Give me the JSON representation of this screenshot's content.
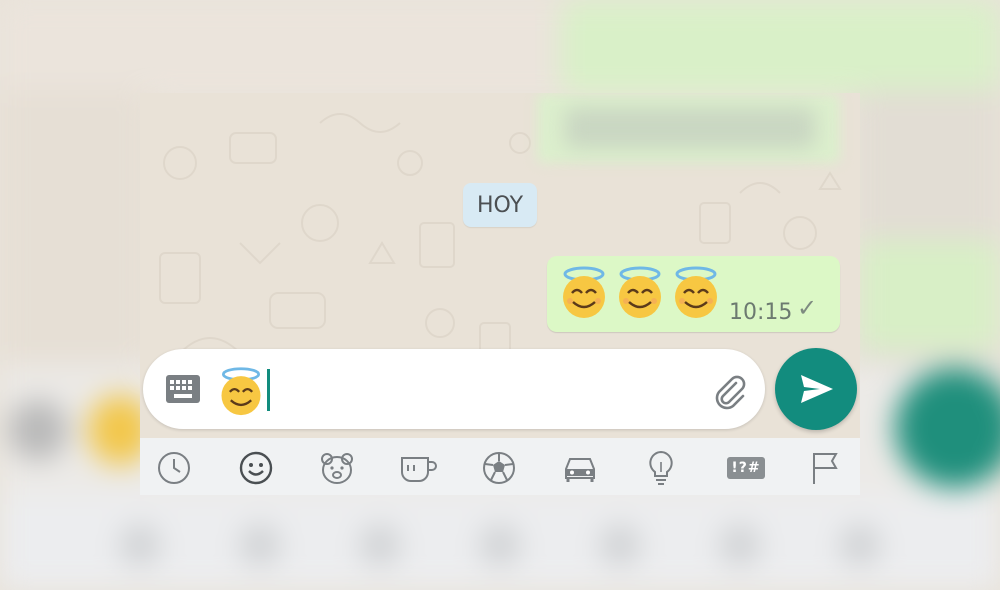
{
  "chat": {
    "date_chip": "HOY",
    "outgoing_message": {
      "emoji_count": 3,
      "emoji_name": "smiling-face-with-halo",
      "time": "10:15",
      "status": "sent-check"
    }
  },
  "composer": {
    "keyboard_toggle_icon": "keyboard-icon",
    "typed_emoji": "smiling-face-with-halo",
    "attach_icon": "paperclip-icon",
    "send_icon": "send-arrow-icon"
  },
  "emoji_tabs": [
    {
      "name": "recent-icon",
      "selected": false
    },
    {
      "name": "smileys-icon",
      "selected": true
    },
    {
      "name": "animals-icon",
      "selected": false
    },
    {
      "name": "food-icon",
      "selected": false
    },
    {
      "name": "activity-icon",
      "selected": false
    },
    {
      "name": "travel-icon",
      "selected": false
    },
    {
      "name": "objects-icon",
      "selected": false
    },
    {
      "name": "symbols-icon",
      "label": "!?#",
      "selected": false
    },
    {
      "name": "flags-icon",
      "selected": false
    }
  ],
  "colors": {
    "accent": "#128c7e",
    "outgoing_bubble": "#dcf8c6",
    "date_chip": "#d8eaf4",
    "chat_background": "#e9e2d7"
  }
}
